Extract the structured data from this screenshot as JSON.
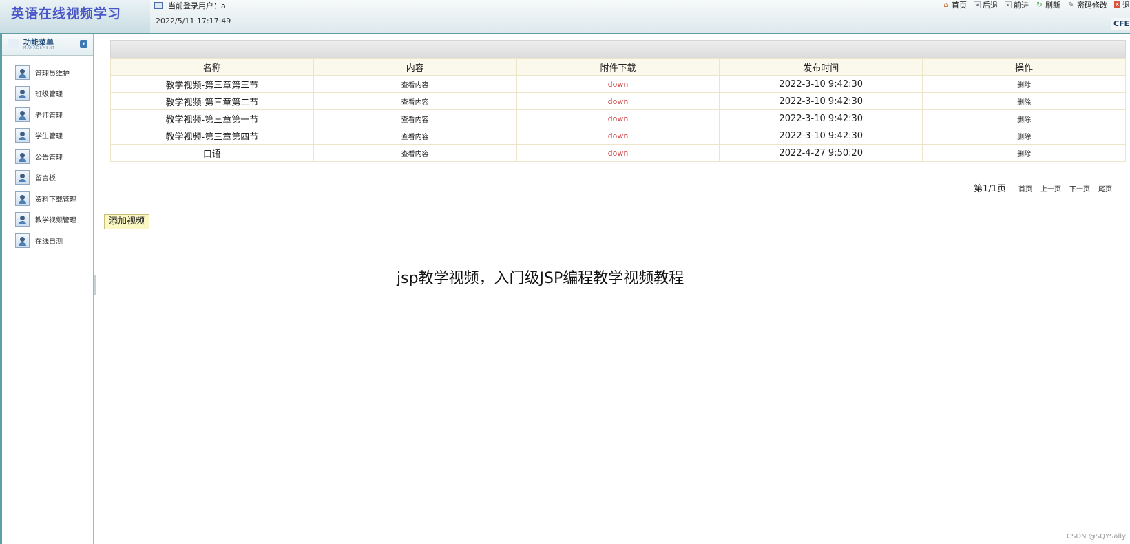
{
  "app": {
    "title": "英语在线视频学习",
    "current_user_label": "当前登录用户：a",
    "datetime": "2022/5/11 17:17:49",
    "corner_tag": "CFE"
  },
  "top_nav": [
    {
      "label": "首页",
      "icon": "home-icon"
    },
    {
      "label": "后退",
      "icon": "back-icon"
    },
    {
      "label": "前进",
      "icon": "forward-icon"
    },
    {
      "label": "刷新",
      "icon": "refresh-icon"
    },
    {
      "label": "密码修改",
      "icon": "password-edit-icon"
    },
    {
      "label": "退",
      "icon": "exit-icon"
    }
  ],
  "sidebar": {
    "title": "功能菜单",
    "subtitle": "MANAGEMENT",
    "collapse_symbol": "▾",
    "items": [
      {
        "label": "管理员维护"
      },
      {
        "label": "班级管理"
      },
      {
        "label": "老师管理"
      },
      {
        "label": "学生管理"
      },
      {
        "label": "公告管理"
      },
      {
        "label": "留言板"
      },
      {
        "label": "资料下载管理"
      },
      {
        "label": "教学视频管理"
      },
      {
        "label": "在线自测"
      }
    ]
  },
  "table": {
    "columns": [
      "名称",
      "内容",
      "附件下载",
      "发布时间",
      "操作"
    ],
    "rows": [
      {
        "name": "教学视频-第三章第三节",
        "content": "查看内容",
        "attachment": "down",
        "published": "2022-3-10 9:42:30",
        "action": "删除"
      },
      {
        "name": "教学视频-第三章第二节",
        "content": "查看内容",
        "attachment": "down",
        "published": "2022-3-10 9:42:30",
        "action": "删除"
      },
      {
        "name": "教学视频-第三章第一节",
        "content": "查看内容",
        "attachment": "down",
        "published": "2022-3-10 9:42:30",
        "action": "删除"
      },
      {
        "name": "教学视频-第三章第四节",
        "content": "查看内容",
        "attachment": "down",
        "published": "2022-3-10 9:42:30",
        "action": "删除"
      },
      {
        "name": "口语",
        "content": "查看内容",
        "attachment": "down",
        "published": "2022-4-27 9:50:20",
        "action": "删除"
      }
    ]
  },
  "pager": {
    "info": "第1/1页",
    "first": "首页",
    "prev": "上一页",
    "next": "下一页",
    "last": "尾页"
  },
  "add_button": "添加视频",
  "caption": "jsp教学视频，入门级JSP编程教学视频教程",
  "watermark": "CSDN @SQYSally",
  "colors": {
    "brand_title": "#4a56c8",
    "accent_border": "#5f9ea5",
    "link_red": "#d24b4b",
    "header_row_bg": "#fbf8ec",
    "add_button_bg": "#fbf7c2"
  }
}
